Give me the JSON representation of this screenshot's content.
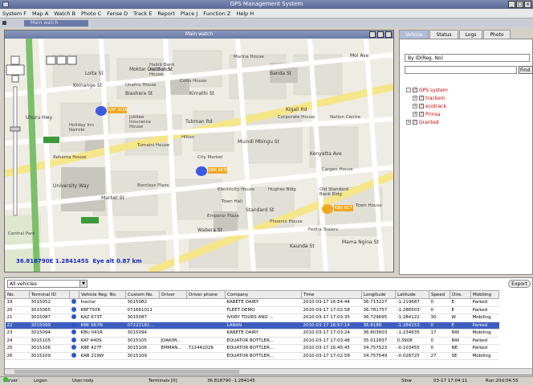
{
  "window": {
    "title": "GPS Management System"
  },
  "menu": [
    "System F",
    "Map A",
    "Watch B",
    "Photo C",
    "Fense D",
    "Track E",
    "Report",
    "Place J",
    "Function Z",
    "Help H"
  ],
  "tab": {
    "label": "Main watch"
  },
  "map_window": {
    "title": "Main watch",
    "coords": "36.818790E 1.284145S",
    "eye_alt": "Eye alt 0.87 km",
    "streets": [
      "Banda St",
      "Kenyatta Ave",
      "Muindi Mbingu St",
      "Moi Ave",
      "Biashara St",
      "Mama Ngina St",
      "Koinange St",
      "Market St",
      "Kimathi St",
      "Tubman Rd",
      "Kaunda St",
      "Standard St",
      "Wabera St",
      "University Way",
      "Loita St",
      "Uhuru Hwy",
      "Moktar Daddah St",
      "Kigali Rd"
    ],
    "places": [
      "Habib Bank AG Zurich House",
      "Marina House",
      "Unafric House",
      "Cotts House",
      "Jubilee Insurance House",
      "City Market",
      "Corporate House",
      "Hilton",
      "Barclays Plaza",
      "Tumaini House",
      "Central Park",
      "Holiday Inn Nairobi",
      "Nation Centre",
      "Electricity House",
      "Hughes Bldg",
      "Cargen House",
      "Old Standard Bank Bldg",
      "Town House",
      "Phoenix House",
      "Fedha Towers",
      "Emperor Plaza",
      "Rehema House",
      "Town Hall"
    ],
    "vehicle_labels": [
      "KAF 3256",
      "KBK 667N",
      "KBU 017"
    ]
  },
  "right_panel": {
    "tabs": [
      "Vehicle",
      "Status",
      "Logs",
      "Photo"
    ],
    "search_by": "By ID(Reg. No)",
    "find_label": "Find",
    "tree": [
      {
        "label": "GPS system",
        "level": 0
      },
      {
        "label": "trackem",
        "level": 1
      },
      {
        "label": "ecotrack",
        "level": 1
      },
      {
        "label": "Prinsa",
        "level": 1
      },
      {
        "label": "Granted",
        "level": 0
      }
    ]
  },
  "vehicle_table": {
    "filter": "All vehicles",
    "export_label": "Export",
    "columns": [
      "No.",
      "Terminal ID",
      "",
      "Vehicle Reg. No.",
      "Custom No.",
      "Driver",
      "Driver phone",
      "Company",
      "Time",
      "Longitude",
      "Latitude",
      "Speed",
      "Dire.",
      "Mobiling"
    ],
    "rows": [
      [
        "19",
        "3015052",
        "",
        "tractor",
        "3015082",
        "",
        "",
        "KABETE DAIRY",
        "2010-03-17 16:54:44",
        "36.713227",
        "-1.219687",
        "0",
        "E",
        "Parked"
      ],
      [
        "20",
        "3015065",
        "",
        "KBF750K",
        "071661011",
        "",
        "",
        "FLEET DEMO",
        "2010-03-17 17:02:58",
        "36.781757",
        "-1.286503",
        "0",
        "E",
        "Parked"
      ],
      [
        "21",
        "3015087",
        "",
        "KAZ 673T",
        "3015087",
        "",
        "",
        "IVORY TOURS AND ...",
        "2010-03-17 17:03:35",
        "36.729695",
        "-1.284122",
        "30",
        "W",
        "Mobiling"
      ],
      [
        "22",
        "3015099",
        "",
        "KBK 667N",
        "07222181...",
        "",
        "",
        "LABAN",
        "2010-03-17 16:57:14",
        "36.8188",
        "-1.284153",
        "0",
        "E",
        "Parked"
      ],
      [
        "23",
        "3015094",
        "",
        "KBU 041R",
        "3015094",
        "",
        "",
        "KABETE DAIRY",
        "2010-03-17 17:03:24",
        "36.803603",
        "-1.234635",
        "17",
        "NW",
        "Mobiling"
      ],
      [
        "24",
        "3015105",
        "",
        "KAT 440S",
        "3015105",
        "JOAKIM...",
        "",
        "EQUATOR BOTTLER...",
        "2010-03-17 17:03:48",
        "35.012837",
        "0.3908",
        "0",
        "NW",
        "Parked"
      ],
      [
        "25",
        "3015106",
        "",
        "KBE 427F",
        "3015106",
        "EMMAN...",
        "721442026",
        "EQUATOR BOTTLER...",
        "2010-03-17 16:45:45",
        "34.757523",
        "-0.103455",
        "0",
        "NE",
        "Parked"
      ],
      [
        "26",
        "3015109",
        "",
        "KAB 219W",
        "3015109",
        "",
        "",
        "EQUATOR BOTTLER...",
        "2010-03-17 17:02:58",
        "34.757549",
        "-0.028725",
        "27",
        "SE",
        "Mobiling"
      ]
    ],
    "selected_index": 3
  },
  "status_bar": {
    "server": "Server",
    "logon": "Logon",
    "user": "User:rody",
    "terminals": "Terminals [0]",
    "position": "36.818790 -1.284145",
    "slow": "Slow",
    "time": "03-17 17:04:11",
    "run": "Run:20d:04:55"
  }
}
